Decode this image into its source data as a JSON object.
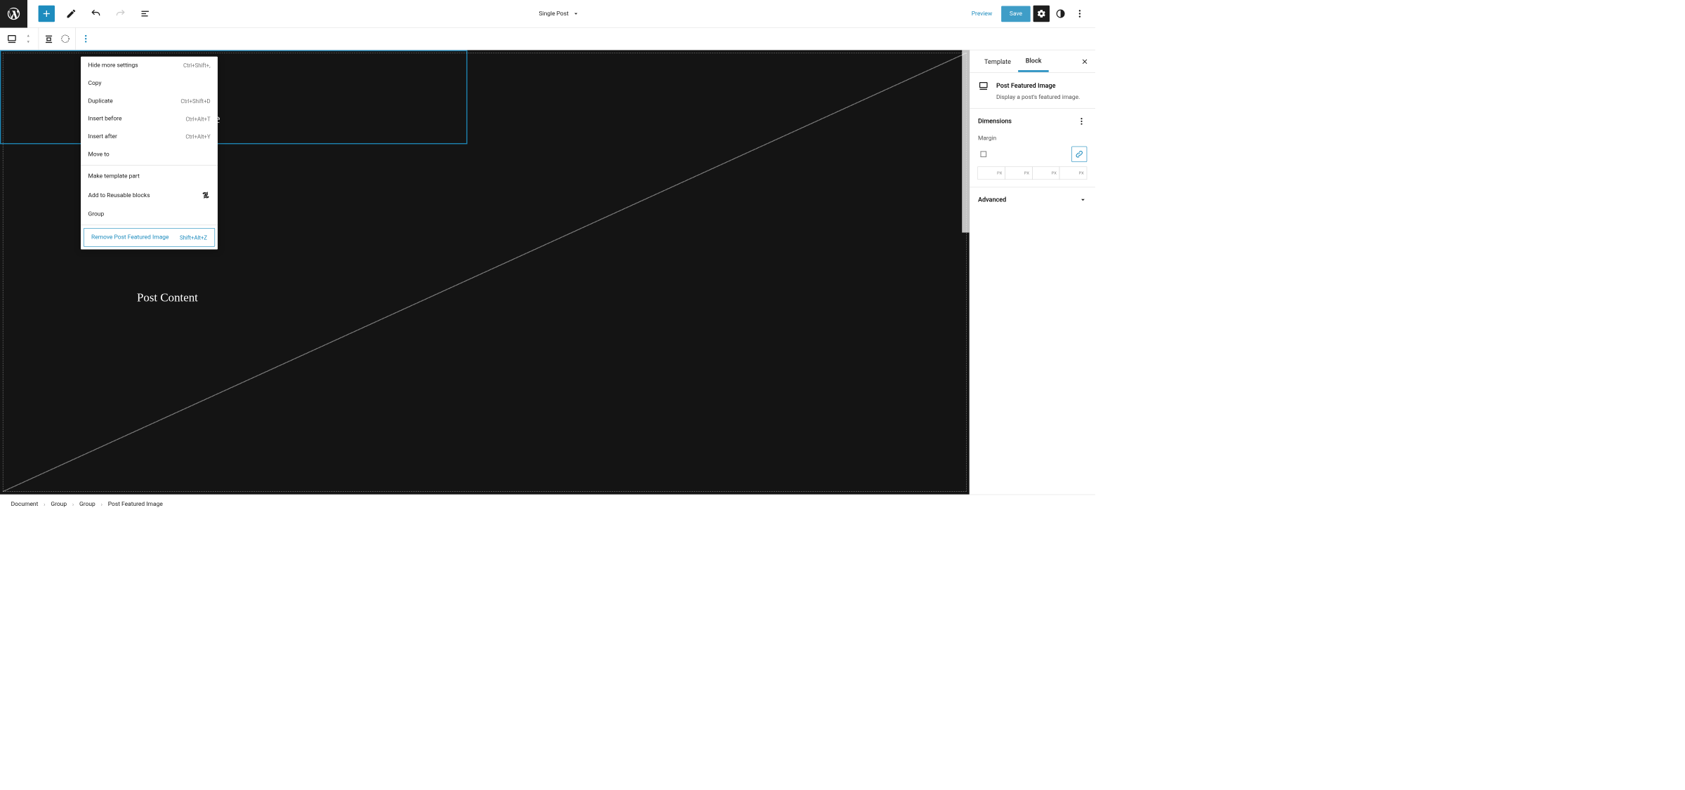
{
  "toolbar": {
    "page_title": "Single Post",
    "preview_label": "Preview",
    "save_label": "Save"
  },
  "context_menu": {
    "items": [
      {
        "label": "Hide more settings",
        "shortcut": "Ctrl+Shift+,",
        "icon": null
      },
      {
        "label": "Copy",
        "shortcut": "",
        "icon": null
      },
      {
        "label": "Duplicate",
        "shortcut": "Ctrl+Shift+D",
        "icon": null
      },
      {
        "label": "Insert before",
        "shortcut": "Ctrl+Alt+T",
        "icon": null
      },
      {
        "label": "Insert after",
        "shortcut": "Ctrl+Alt+Y",
        "icon": null
      },
      {
        "label": "Move to",
        "shortcut": "",
        "icon": null
      }
    ],
    "items2": [
      {
        "label": "Make template part",
        "shortcut": "",
        "icon": null
      },
      {
        "label": "Add to Reusable blocks",
        "shortcut": "",
        "icon": "retry"
      },
      {
        "label": "Group",
        "shortcut": "",
        "icon": null
      }
    ],
    "remove": {
      "label": "Remove Post Featured Image",
      "shortcut": "Shift+Alt+Z"
    }
  },
  "editor": {
    "post_content_label": "Post Content"
  },
  "sidebar": {
    "tabs": {
      "template": "Template",
      "block": "Block"
    },
    "block": {
      "title": "Post Featured Image",
      "description": "Display a post's featured image."
    },
    "dimensions": {
      "title": "Dimensions",
      "margin_label": "Margin",
      "px_unit": "PX"
    },
    "advanced_label": "Advanced"
  },
  "breadcrumb": [
    "Document",
    "Group",
    "Group",
    "Post Featured Image"
  ]
}
